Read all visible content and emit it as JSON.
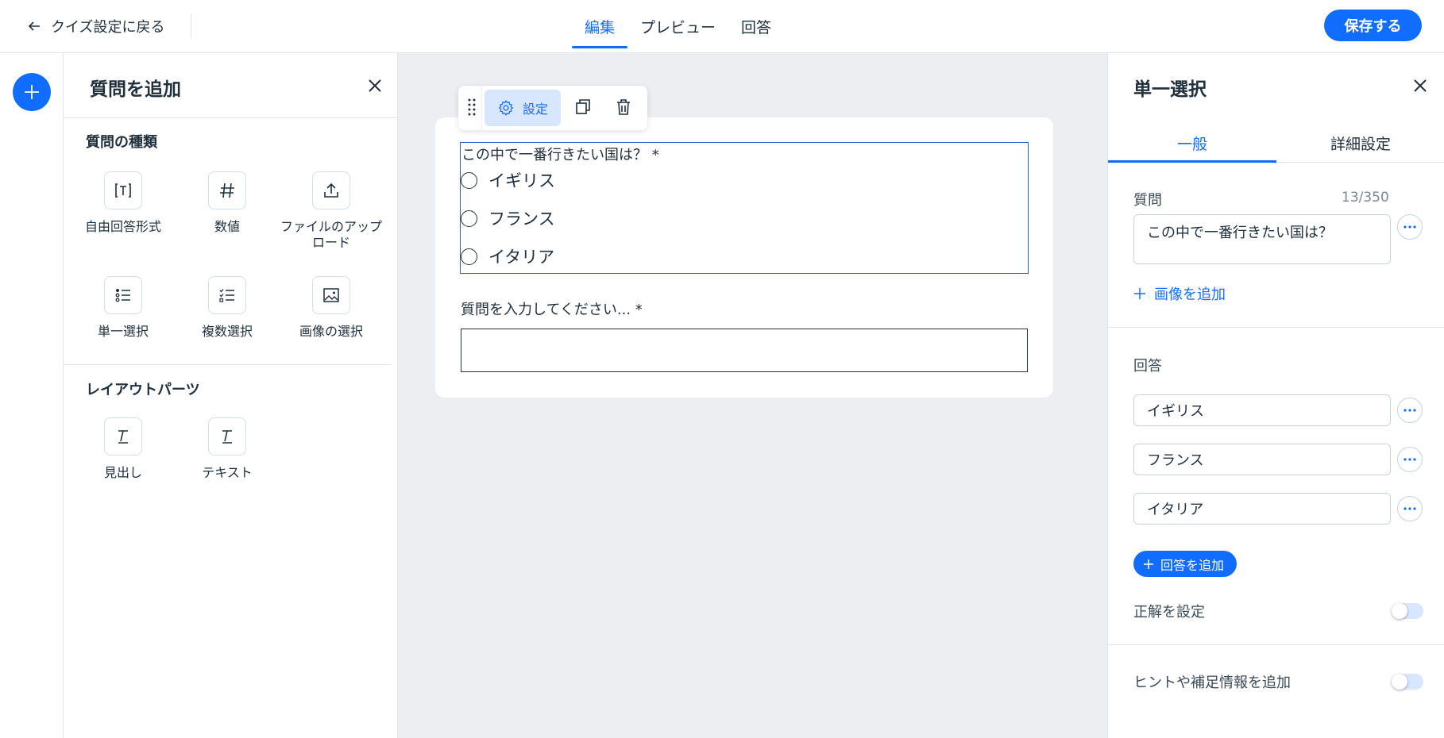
{
  "header": {
    "back_label": "クイズ設定に戻る",
    "tabs": [
      {
        "label": "編集",
        "active": true
      },
      {
        "label": "プレビュー",
        "active": false
      },
      {
        "label": "回答",
        "active": false
      }
    ],
    "save_label": "保存する"
  },
  "add_panel": {
    "title": "質問を追加",
    "question_types_title": "質問の種類",
    "question_types": [
      {
        "label": "自由回答形式",
        "icon": "text-field-icon"
      },
      {
        "label": "数値",
        "icon": "hash-icon"
      },
      {
        "label": "ファイルのアップロード",
        "icon": "upload-icon"
      },
      {
        "label": "単一選択",
        "icon": "single-choice-list-icon"
      },
      {
        "label": "複数選択",
        "icon": "multi-choice-list-icon"
      },
      {
        "label": "画像の選択",
        "icon": "image-icon"
      }
    ],
    "layout_title": "レイアウトパーツ",
    "layout_parts": [
      {
        "label": "見出し",
        "icon": "heading-icon"
      },
      {
        "label": "テキスト",
        "icon": "text-icon"
      }
    ]
  },
  "canvas": {
    "toolbar": {
      "settings_label": "設定"
    },
    "question1": {
      "text": "この中で一番行きたい国は？ *",
      "options": [
        "イギリス",
        "フランス",
        "イタリア"
      ]
    },
    "question2": {
      "text": "質問を入力してください... *"
    }
  },
  "settings_panel": {
    "title": "単一選択",
    "tabs": [
      {
        "label": "一般",
        "active": true
      },
      {
        "label": "詳細設定",
        "active": false
      }
    ],
    "question_label": "質問",
    "question_counter": "13/350",
    "question_value": "この中で一番行きたい国は？",
    "add_image_label": "画像を追加",
    "answers_label": "回答",
    "answers": [
      "イギリス",
      "フランス",
      "イタリア"
    ],
    "add_answer_label": "回答を追加",
    "correct_answer_label": "正解を設定",
    "correct_answer_on": false,
    "hint_label": "ヒントや補足情報を追加",
    "hint_on": false
  },
  "colors": {
    "accent": "#116dff",
    "canvas_bg": "#eceef2",
    "text": "#20303c"
  }
}
